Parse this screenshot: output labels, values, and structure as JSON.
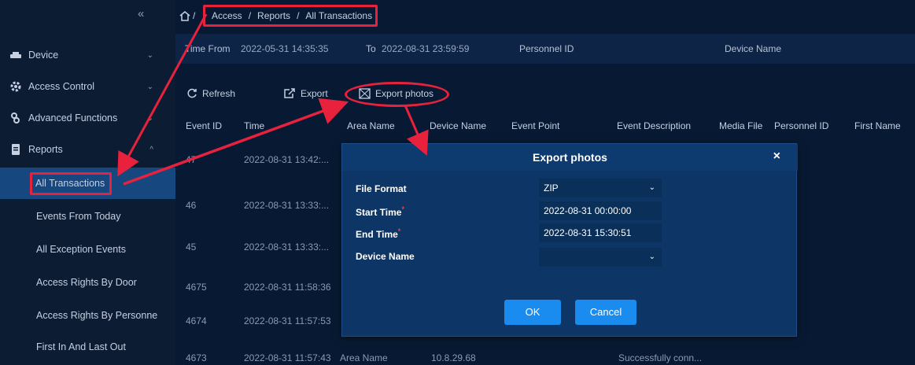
{
  "sidebar": {
    "collapse_glyph": "«",
    "items": [
      {
        "label": "Device",
        "icon": "device-icon",
        "chevron": "⌄"
      },
      {
        "label": "Access Control",
        "icon": "gear-icon",
        "chevron": "⌄"
      },
      {
        "label": "Advanced Functions",
        "icon": "advanced-icon",
        "chevron": "⌄"
      },
      {
        "label": "Reports",
        "icon": "reports-icon",
        "chevron": "^"
      }
    ],
    "sub_items": [
      {
        "label": "All Transactions",
        "active": true
      },
      {
        "label": "Events From Today"
      },
      {
        "label": "All Exception Events"
      },
      {
        "label": "Access Rights By Door"
      },
      {
        "label": "Access Rights By Personne"
      },
      {
        "label": "First In And Last Out"
      }
    ]
  },
  "breadcrumb": {
    "sep0": "/",
    "items": [
      "Access",
      "Reports",
      "All Transactions"
    ],
    "sep": "/"
  },
  "filters": {
    "time_from_label": "Time From",
    "time_from_value": "2022-05-31 14:35:35",
    "to_label": "To",
    "to_value": "2022-08-31 23:59:59",
    "personnel_id_label": "Personnel ID",
    "device_name_label": "Device Name"
  },
  "toolbar": {
    "refresh_label": "Refresh",
    "export_label": "Export",
    "export_photos_label": "Export photos"
  },
  "table": {
    "headers": [
      "Event ID",
      "Time",
      "Area Name",
      "Device Name",
      "Event Point",
      "Event Description",
      "Media File",
      "Personnel ID",
      "First Name"
    ],
    "rows": [
      {
        "event_id": "47",
        "time": "2022-08-31 13:42:..."
      },
      {
        "event_id": "46",
        "time": "2022-08-31 13:33:..."
      },
      {
        "event_id": "45",
        "time": "2022-08-31 13:33:..."
      },
      {
        "event_id": "4675",
        "time": "2022-08-31 11:58:36"
      },
      {
        "event_id": "4674",
        "time": "2022-08-31 11:57:53"
      },
      {
        "event_id": "4673",
        "time": "2022-08-31 11:57:43",
        "area": "Area Name",
        "device": "10.8.29.68",
        "description": "Successfully conn..."
      }
    ]
  },
  "dialog": {
    "title": "Export photos",
    "close_glyph": "×",
    "file_format_label": "File Format",
    "file_format_value": "ZIP",
    "start_time_label": "Start Time",
    "start_time_value": "2022-08-31 00:00:00",
    "end_time_label": "End Time",
    "end_time_value": "2022-08-31 15:30:51",
    "device_name_label": "Device Name",
    "device_name_value": "",
    "required_mark": "*",
    "caret": "⌄",
    "ok_label": "OK",
    "cancel_label": "Cancel"
  },
  "colors": {
    "background": "#081a33",
    "sidebar": "#0c1c33",
    "active_item": "#17477f",
    "dialog": "#0d3666",
    "button": "#1a8cf0",
    "annotation": "#e8213d"
  }
}
